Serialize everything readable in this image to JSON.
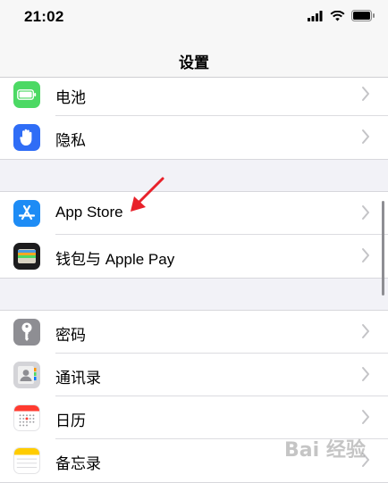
{
  "status_bar": {
    "time": "21:02"
  },
  "nav": {
    "title": "设置"
  },
  "groups": [
    {
      "items": [
        {
          "label": "电池",
          "icon": "battery-icon"
        },
        {
          "label": "隐私",
          "icon": "hand-privacy-icon"
        }
      ]
    },
    {
      "items": [
        {
          "label": "App Store",
          "icon": "app-store-icon"
        },
        {
          "label": "钱包与 Apple Pay",
          "icon": "wallet-icon"
        }
      ]
    },
    {
      "items": [
        {
          "label": "密码",
          "icon": "key-icon"
        },
        {
          "label": "通讯录",
          "icon": "contacts-icon"
        },
        {
          "label": "日历",
          "icon": "calendar-icon"
        },
        {
          "label": "备忘录",
          "icon": "notes-icon"
        }
      ]
    }
  ],
  "colors": {
    "battery": "#4cd964",
    "privacy": "#2f6df6",
    "app_store": "#1e8cf5",
    "wallet": "#1c1c1e",
    "passwords": "#8e8e93",
    "contacts": "#c8c8cc",
    "calendar_red": "#ff3b30",
    "notes_yellow": "#ffcc00",
    "annotation_arrow": "#e8212a"
  },
  "watermark": {
    "text": "Bai 经验"
  }
}
